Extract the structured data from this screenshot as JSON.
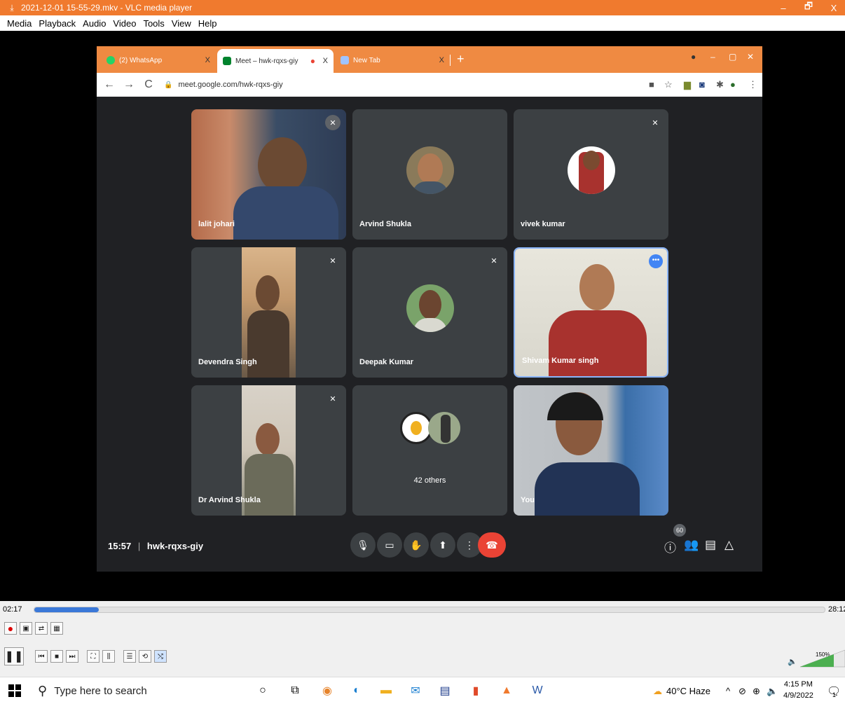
{
  "vlc": {
    "title": "2021-12-01 15-55-29.mkv - VLC media player",
    "menu": [
      "Media",
      "Playback",
      "Audio",
      "Video",
      "Tools",
      "View",
      "Help"
    ],
    "window_controls": [
      "–",
      "🗗",
      "X"
    ],
    "time_elapsed": "02:17",
    "time_total": "28:12",
    "progress": 0.082,
    "volume_label": "150%",
    "volume": 1.5
  },
  "browser": {
    "tabs": [
      {
        "label": "(2) WhatsApp",
        "close": "X"
      },
      {
        "label": "Meet – hwk-rqxs-giy",
        "close": "X"
      },
      {
        "label": "New Tab",
        "close": "X"
      }
    ],
    "new_tab": "+",
    "url": "meet.google.com/hwk-rqxs-giy",
    "nav_back": "←",
    "nav_forward": "→",
    "nav_reload": "C"
  },
  "meet": {
    "participants": [
      {
        "name": "lalit johari"
      },
      {
        "name": "Arvind Shukla"
      },
      {
        "name": "vivek kumar"
      },
      {
        "name": "Devendra Singh"
      },
      {
        "name": "Deepak Kumar"
      },
      {
        "name": "Shivam Kumar singh"
      },
      {
        "name": "Dr Arvind Shukla"
      },
      {
        "name": "42 others"
      },
      {
        "name": "You"
      }
    ],
    "more_dots": "•••",
    "meeting_time": "15:57",
    "meeting_code": "hwk-rqxs-giy",
    "separator": "|",
    "people_count": "60"
  },
  "taskbar": {
    "search_placeholder": "Type here to search",
    "weather": "40°C  Haze",
    "time": "4:15 PM",
    "date": "4/9/2022",
    "notification_count": "1"
  },
  "colors": {
    "vlc_orange": "#f07a2e",
    "meet_bg": "#202124",
    "tile_bg": "#3c4043",
    "end_call": "#ea4335",
    "seek_fill": "#3a78d8"
  }
}
